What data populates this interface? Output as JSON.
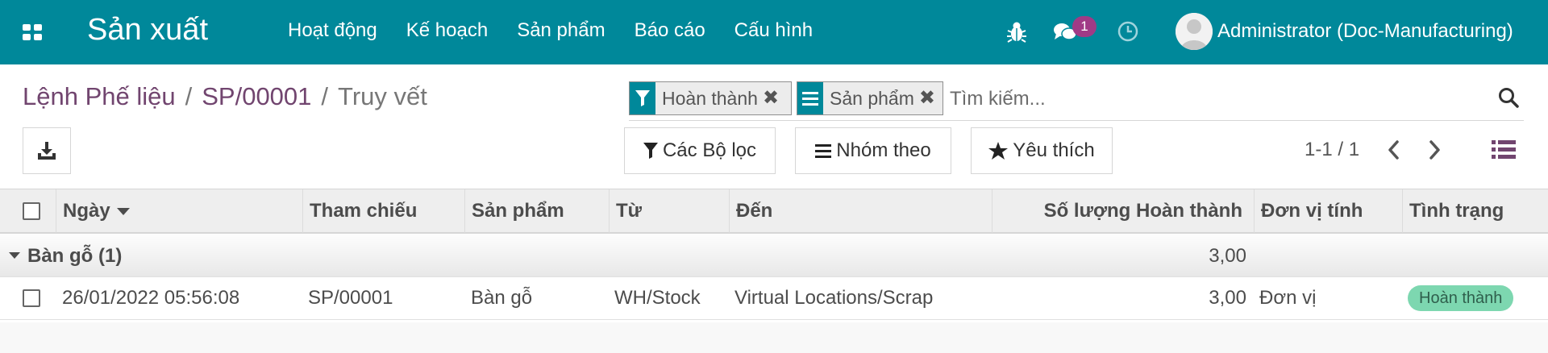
{
  "navbar": {
    "app_name": "Sản xuất",
    "menu": [
      "Hoạt động",
      "Kế hoạch",
      "Sản phẩm",
      "Báo cáo",
      "Cấu hình"
    ],
    "chat_badge": "1",
    "user": "Administrator (Doc-Manufacturing)"
  },
  "breadcrumb": {
    "items": [
      "Lệnh Phế liệu",
      "SP/00001"
    ],
    "separator": "/",
    "current": "Truy vết"
  },
  "search": {
    "facets": [
      {
        "icon": "filter-icon",
        "label": "Hoàn thành"
      },
      {
        "icon": "group-by-icon",
        "label": "Sản phẩm"
      }
    ],
    "placeholder": "Tìm kiếm..."
  },
  "toolbar": {
    "filters_label": "Các Bộ lọc",
    "group_by_label": "Nhóm theo",
    "favorites_label": "Yêu thích"
  },
  "pager": {
    "value": "1-1 / 1"
  },
  "table": {
    "columns": [
      "Ngày",
      "Tham chiếu",
      "Sản phẩm",
      "Từ",
      "Đến",
      "Số lượng Hoàn thành",
      "Đơn vị tính",
      "Tình trạng"
    ],
    "groups": [
      {
        "label": "Bàn gỗ (1)",
        "sum": "3,00",
        "rows": [
          {
            "date": "26/01/2022 05:56:08",
            "reference": "SP/00001",
            "product": "Bàn gỗ",
            "from": "WH/Stock",
            "to": "Virtual Locations/Scrap",
            "qty": "3,00",
            "uom": "Đơn vị",
            "status": "Hoàn thành"
          }
        ]
      }
    ]
  },
  "colors": {
    "navbar": "#00889a",
    "breadcrumb_link": "#71456f",
    "badge": "#a03a86",
    "status_done": "#7dd7b0"
  }
}
